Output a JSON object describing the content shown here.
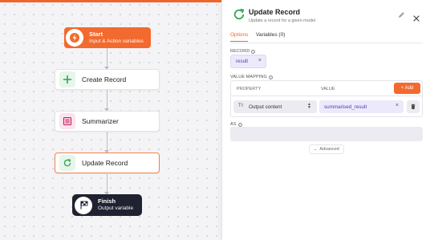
{
  "canvas": {
    "accent_color": "#f0652a",
    "nodes": {
      "start": {
        "title": "Start",
        "subtitle": "Input & Action variables",
        "icon": "lightning-icon"
      },
      "create_record": {
        "label": "Create Record",
        "icon": "plus-icon"
      },
      "summarizer": {
        "label": "Summarizer",
        "icon": "summarizer-icon"
      },
      "update_record": {
        "label": "Update Record",
        "icon": "refresh-icon",
        "selected": true
      },
      "finish": {
        "title": "Finish",
        "subtitle": "Output variable",
        "icon": "checkered-flag-icon"
      }
    }
  },
  "panel": {
    "title": "Update Record",
    "description": "Update a record for a given model",
    "tabs": [
      {
        "label": "Options",
        "active": true
      },
      {
        "label": "Variables (0)",
        "active": false
      }
    ],
    "record": {
      "label": "RECORD",
      "value": "result",
      "remove": "×"
    },
    "value_mapping": {
      "label": "VALUE MAPPING",
      "columns": {
        "property": "PROPERTY",
        "value": "VALUE"
      },
      "add_button": "+ Add",
      "rows": [
        {
          "property": "Output content",
          "property_icon": "Tт",
          "value": "summarised_result",
          "remove": "×"
        }
      ]
    },
    "as": {
      "label": "AS",
      "value": ""
    },
    "advanced_button": "Advanced"
  }
}
